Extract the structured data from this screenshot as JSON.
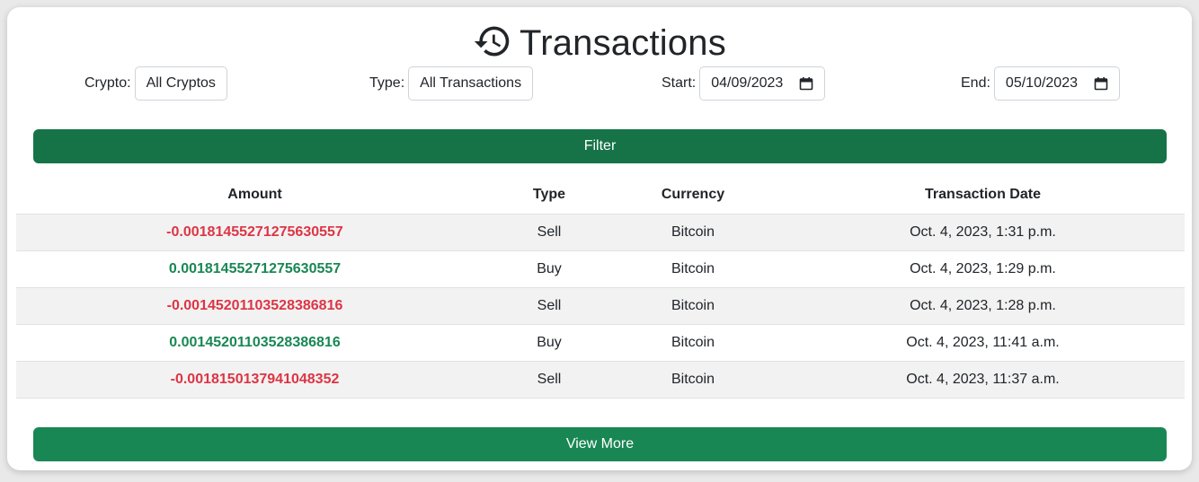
{
  "header": {
    "title": "Transactions",
    "icon": "history-icon"
  },
  "filters": {
    "crypto": {
      "label": "Crypto:",
      "value": "All Cryptos"
    },
    "type": {
      "label": "Type:",
      "value": "All Transactions"
    },
    "start": {
      "label": "Start:",
      "value": "04/09/2023"
    },
    "end": {
      "label": "End:",
      "value": "05/10/2023"
    }
  },
  "buttons": {
    "filter": "Filter",
    "view_more": "View More"
  },
  "table": {
    "headers": [
      "Amount",
      "Type",
      "Currency",
      "Transaction Date"
    ],
    "rows": [
      {
        "amount": "-0.00181455271275630557",
        "type": "Sell",
        "currency": "Bitcoin",
        "date": "Oct. 4, 2023, 1:31 p.m."
      },
      {
        "amount": "0.00181455271275630557",
        "type": "Buy",
        "currency": "Bitcoin",
        "date": "Oct. 4, 2023, 1:29 p.m."
      },
      {
        "amount": "-0.0014520110352838681​6",
        "type": "Sell",
        "currency": "Bitcoin",
        "date": "Oct. 4, 2023, 1:28 p.m."
      },
      {
        "amount": "0.00145201103528386816",
        "type": "Buy",
        "currency": "Bitcoin",
        "date": "Oct. 4, 2023, 11:41 a.m."
      },
      {
        "amount": "-0.0018150137941048352",
        "type": "Sell",
        "currency": "Bitcoin",
        "date": "Oct. 4, 2023, 11:37 a.m."
      }
    ]
  },
  "colors": {
    "sell": "#dc3545",
    "buy": "#198754",
    "filter_button": "#157347",
    "view_more_button": "#198754"
  }
}
